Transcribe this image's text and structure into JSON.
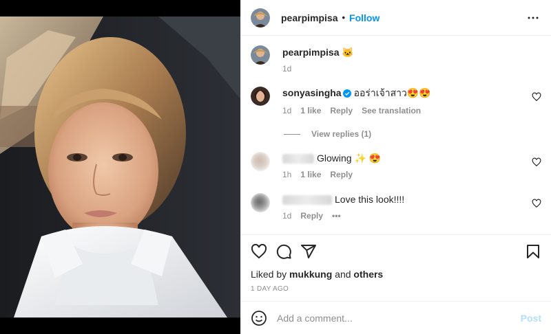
{
  "header": {
    "username": "pearpimpisa",
    "separator": "•",
    "follow_label": "Follow",
    "more_icon": "more-horizontal-icon"
  },
  "caption": {
    "username": "pearpimpisa",
    "text": "🐱",
    "time": "1d"
  },
  "comments": [
    {
      "username": "sonyasingha",
      "verified": true,
      "text": "ออร่าเจ้าสาว😍😍",
      "time": "1d",
      "likes": "1 like",
      "reply_label": "Reply",
      "translate_label": "See translation",
      "view_replies": "View replies (1)"
    },
    {
      "username_hidden": true,
      "text": "Glowing ✨ 😍",
      "time": "1h",
      "likes": "1 like",
      "reply_label": "Reply"
    },
    {
      "username_hidden": true,
      "text": "Love this look!!!!",
      "time": "1d",
      "reply_label": "Reply",
      "options_label": "•••"
    }
  ],
  "actions": {
    "like_icon": "heart-icon",
    "comment_icon": "comment-icon",
    "share_icon": "share-icon",
    "save_icon": "bookmark-icon"
  },
  "liked_by": {
    "prefix": "Liked by",
    "user": "mukkung",
    "and": "and",
    "others": "others"
  },
  "posted_time": "1 DAY AGO",
  "add_comment": {
    "placeholder": "Add a comment...",
    "post_label": "Post",
    "emoji_icon": "emoji-icon"
  },
  "colors": {
    "link_blue": "#0095f6",
    "post_disabled": "#b2dffc",
    "muted": "#8e8e8e",
    "text": "#262626"
  }
}
